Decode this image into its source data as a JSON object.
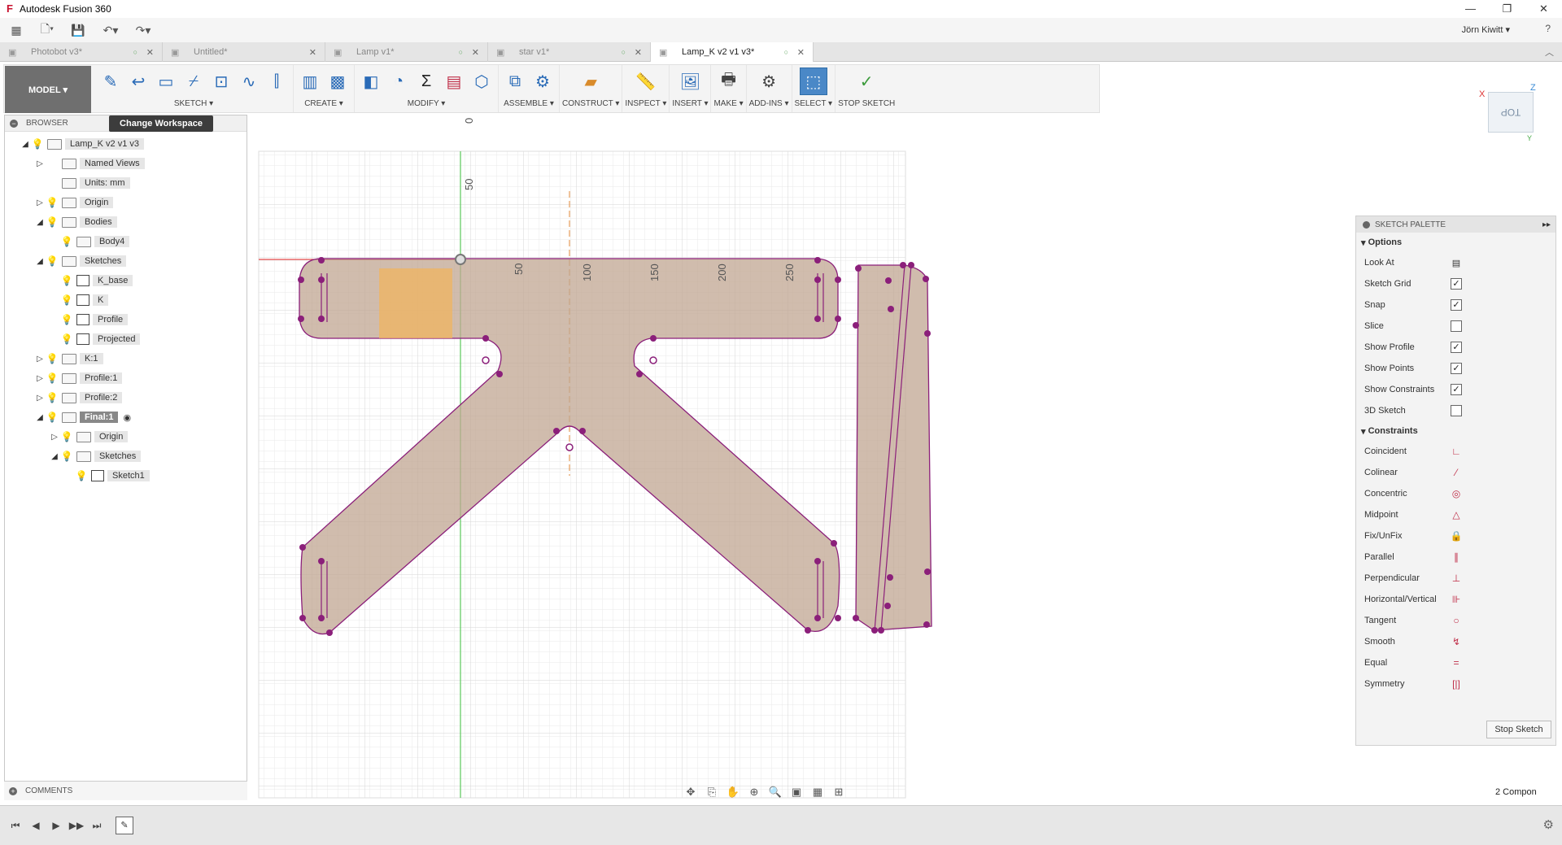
{
  "window": {
    "title": "Autodesk Fusion 360",
    "controls": [
      "—",
      "❐",
      "✕"
    ]
  },
  "quick_access": {
    "user": "Jörn Kiwitt ▾",
    "help": "?"
  },
  "tabs": [
    {
      "label": "Photobot v3*",
      "active": false
    },
    {
      "label": "Untitled*",
      "active": false
    },
    {
      "label": "Lamp v1*",
      "active": false
    },
    {
      "label": "star v1*",
      "active": false
    },
    {
      "label": "Lamp_K v2 v1 v3*",
      "active": true
    }
  ],
  "toolbar": {
    "workspace": "MODEL ▾",
    "groups": [
      {
        "label": "SKETCH ▾",
        "icons": [
          "sketch-create-icon",
          "arc-icon",
          "rectangle-icon",
          "line-icon",
          "slot-icon",
          "spline-icon",
          "mirror-icon"
        ]
      },
      {
        "label": "CREATE ▾",
        "icons": [
          "extrude-icon",
          "form-icon"
        ]
      },
      {
        "label": "MODIFY ▾",
        "icons": [
          "press-pull-icon",
          "fillet-icon",
          "parameters-icon",
          "table-icon",
          "shell-icon"
        ]
      },
      {
        "label": "ASSEMBLE ▾",
        "icons": [
          "new-component-icon",
          "joint-icon"
        ]
      },
      {
        "label": "CONSTRUCT ▾",
        "icons": [
          "offset-plane-icon"
        ]
      },
      {
        "label": "INSPECT ▾",
        "icons": [
          "measure-icon"
        ]
      },
      {
        "label": "INSERT ▾",
        "icons": [
          "insert-image-icon"
        ]
      },
      {
        "label": "MAKE ▾",
        "icons": [
          "3d-print-icon"
        ]
      },
      {
        "label": "ADD-INS ▾",
        "icons": [
          "scripts-icon"
        ]
      },
      {
        "label": "SELECT ▾",
        "icons": [
          "select-icon"
        ]
      },
      {
        "label": "STOP SKETCH",
        "icons": [
          "stop-sketch-icon"
        ]
      }
    ]
  },
  "browser": {
    "header": "BROWSER",
    "change_workspace": "Change Workspace",
    "nodes": [
      {
        "label": "Lamp_K v2 v1 v3",
        "level": 0,
        "arrow": "◢",
        "bulb": true,
        "icon": "doc"
      },
      {
        "label": "Named Views",
        "level": 1,
        "arrow": "▷",
        "bulb": false,
        "icon": "folder"
      },
      {
        "label": "Units: mm",
        "level": 1,
        "arrow": "",
        "bulb": false,
        "icon": "doc"
      },
      {
        "label": "Origin",
        "level": 1,
        "arrow": "▷",
        "bulb": "blue",
        "icon": "folder"
      },
      {
        "label": "Bodies",
        "level": 1,
        "arrow": "◢",
        "bulb": true,
        "icon": "folder"
      },
      {
        "label": "Body4",
        "level": 2,
        "arrow": "",
        "bulb": true,
        "icon": "body"
      },
      {
        "label": "Sketches",
        "level": 1,
        "arrow": "◢",
        "bulb": true,
        "icon": "folder"
      },
      {
        "label": "K_base",
        "level": 2,
        "arrow": "",
        "bulb": true,
        "icon": "sketch"
      },
      {
        "label": "K",
        "level": 2,
        "arrow": "",
        "bulb": true,
        "icon": "sketch"
      },
      {
        "label": "Profile",
        "level": 2,
        "arrow": "",
        "bulb": "blue",
        "icon": "sketch"
      },
      {
        "label": "Projected",
        "level": 2,
        "arrow": "",
        "bulb": true,
        "icon": "sketch"
      },
      {
        "label": "K:1",
        "level": 1,
        "arrow": "▷",
        "bulb": true,
        "icon": "comp"
      },
      {
        "label": "Profile:1",
        "level": 1,
        "arrow": "▷",
        "bulb": true,
        "icon": "comp"
      },
      {
        "label": "Profile:2",
        "level": 1,
        "arrow": "▷",
        "bulb": true,
        "icon": "comp"
      },
      {
        "label": "Final:1",
        "level": 1,
        "arrow": "◢",
        "bulb": true,
        "icon": "comp",
        "final": true
      },
      {
        "label": "Origin",
        "level": 2,
        "arrow": "▷",
        "bulb": true,
        "icon": "folder"
      },
      {
        "label": "Sketches",
        "level": 2,
        "arrow": "◢",
        "bulb": true,
        "icon": "folder"
      },
      {
        "label": "Sketch1",
        "level": 3,
        "arrow": "",
        "bulb": true,
        "icon": "sketch"
      }
    ],
    "comments": "COMMENTS"
  },
  "canvas": {
    "ruler_labels": [
      "50",
      "100",
      "150",
      "200",
      "250"
    ],
    "axis_label_vertical": "50",
    "axis_label_top": "0"
  },
  "viewcube": {
    "face": "TOP",
    "x": "X",
    "z": "Z",
    "y": "Y"
  },
  "sketch_palette": {
    "title": "SKETCH PALETTE",
    "options_header": "Options",
    "options": [
      {
        "label": "Look At",
        "type": "button"
      },
      {
        "label": "Sketch Grid",
        "type": "check",
        "checked": true
      },
      {
        "label": "Snap",
        "type": "check",
        "checked": true
      },
      {
        "label": "Slice",
        "type": "check",
        "checked": false
      },
      {
        "label": "Show Profile",
        "type": "check",
        "checked": true
      },
      {
        "label": "Show Points",
        "type": "check",
        "checked": true
      },
      {
        "label": "Show Constraints",
        "type": "check",
        "checked": true
      },
      {
        "label": "3D Sketch",
        "type": "check",
        "checked": false
      }
    ],
    "constraints_header": "Constraints",
    "constraints": [
      {
        "label": "Coincident",
        "glyph": "∟"
      },
      {
        "label": "Colinear",
        "glyph": "⁄"
      },
      {
        "label": "Concentric",
        "glyph": "◎"
      },
      {
        "label": "Midpoint",
        "glyph": "△"
      },
      {
        "label": "Fix/UnFix",
        "glyph": "🔒"
      },
      {
        "label": "Parallel",
        "glyph": "∥"
      },
      {
        "label": "Perpendicular",
        "glyph": "⊥"
      },
      {
        "label": "Horizontal/Vertical",
        "glyph": "⊪"
      },
      {
        "label": "Tangent",
        "glyph": "○"
      },
      {
        "label": "Smooth",
        "glyph": "↯"
      },
      {
        "label": "Equal",
        "glyph": "="
      },
      {
        "label": "Symmetry",
        "glyph": "[|]"
      }
    ],
    "stop_button": "Stop Sketch"
  },
  "status": {
    "components": "2 Compon"
  },
  "timeline": {
    "buttons": [
      "⏮",
      "◀",
      "▶",
      "▶▶",
      "⏭"
    ]
  }
}
